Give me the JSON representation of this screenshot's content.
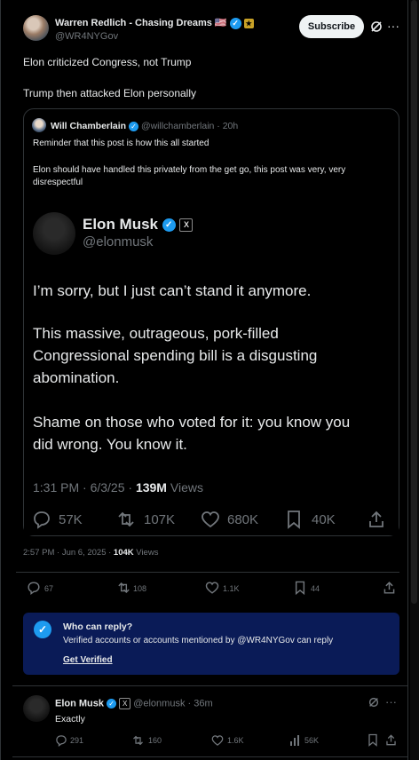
{
  "post": {
    "author_name": "Warren Redlich - Chasing Dreams",
    "author_flag": "🇺🇸",
    "handle": "@WR4NYGov",
    "subscribe_label": "Subscribe",
    "text_line1": "Elon criticized Congress, not Trump",
    "text_line2": "Trump then attacked Elon personally",
    "meta_time": "2:57 PM · Jun 6, 2025 · ",
    "meta_views_count": "104K",
    "meta_views_label": " Views",
    "replies": "67",
    "reposts": "108",
    "likes": "1.1K",
    "bookmarks": "44"
  },
  "quote": {
    "author_name": "Will Chamberlain",
    "handle_time": "@willchamberlain · 20h",
    "text_line1": "Reminder that this post is how this all started",
    "text_line2": "Elon should have handled this privately from the get go, this post was very, very disrespectful"
  },
  "embedded": {
    "name": "Elon Musk",
    "handle": "@elonmusk",
    "para1": "I’m sorry, but I just can’t stand it anymore.",
    "para2_l1": "This massive, outrageous, pork-filled",
    "para2_l2": "Congressional spending bill is a disgusting",
    "para2_l3": "abomination.",
    "para3_l1": "Shame on those who voted for it: you know you",
    "para3_l2": "did wrong. You know it.",
    "time": "1:31 PM · 6/3/25 · ",
    "views_count": "139M",
    "views_label": " Views",
    "replies": "57K",
    "reposts": "107K",
    "likes": "680K",
    "bookmarks": "40K"
  },
  "reply_notice": {
    "title": "Who can reply?",
    "body": "Verified accounts or accounts mentioned by @WR4NYGov can reply",
    "link": "Get Verified"
  },
  "reply": {
    "name": "Elon Musk",
    "handle_time": "@elonmusk · 36m",
    "text": "Exactly",
    "replies": "291",
    "reposts": "160",
    "likes": "1.6K",
    "views": "56K"
  },
  "colors": {
    "accent": "#1d9bf0",
    "muted": "#71767b",
    "notice_bg": "#0a1b57",
    "text": "#e7e9ea"
  }
}
